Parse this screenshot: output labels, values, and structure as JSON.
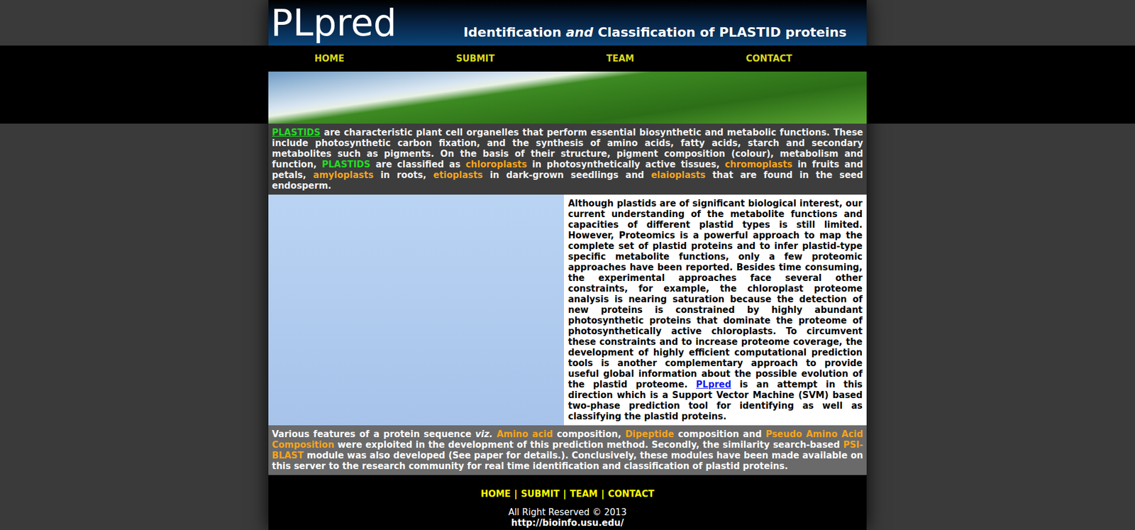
{
  "header": {
    "logo": "PLpred",
    "title": [
      {
        "text": "Identification ",
        "kind": "plain"
      },
      {
        "text": "and",
        "kind": "italic"
      },
      {
        "text": " Classification of PLASTID proteins",
        "kind": "plain"
      }
    ]
  },
  "nav": [
    {
      "label": "HOME"
    },
    {
      "label": "SUBMIT"
    },
    {
      "label": "TEAM"
    },
    {
      "label": "CONTACT"
    }
  ],
  "intro": {
    "segments": [
      {
        "text": "PLASTIDS",
        "kind": "greenlink"
      },
      {
        "text": " are characteristic plant cell organelles that perform essential biosynthetic and metabolic functions. These include photosynthetic carbon fixation, and the synthesis of amino acids, fatty acids, starch and secondary metabolites such as pigments. On the basis of their structure, pigment composition (colour), metabolism and function, ",
        "kind": "plain"
      },
      {
        "text": "PLASTIDS",
        "kind": "green"
      },
      {
        "text": " are classified as ",
        "kind": "plain"
      },
      {
        "text": "chloroplasts",
        "kind": "orange"
      },
      {
        "text": " in photosynthetically active tissues, ",
        "kind": "plain"
      },
      {
        "text": "chromoplasts",
        "kind": "orange"
      },
      {
        "text": " in fruits and petals, ",
        "kind": "plain"
      },
      {
        "text": "amyloplasts",
        "kind": "orange"
      },
      {
        "text": " in roots, ",
        "kind": "plain"
      },
      {
        "text": "etioplasts",
        "kind": "orange"
      },
      {
        "text": " in dark-grown seedlings and ",
        "kind": "plain"
      },
      {
        "text": "elaioplasts",
        "kind": "orange"
      },
      {
        "text": " that are found in the seed endosperm.",
        "kind": "plain"
      }
    ]
  },
  "about": {
    "segments": [
      {
        "text": "Although plastids are of significant biological interest, our current understanding of the metabolite functions and capacities of different plastid types is still limited. However, Proteomics is a powerful approach to map the complete set of plastid proteins and to infer plastid-type specific metabolite functions, only a few proteomic approaches have been reported. Besides time consuming, the experimental approaches face several other constraints, for example, the chloroplast proteome analysis is nearing saturation because the detection of new proteins is constrained by highly abundant photosynthetic proteins that dominate the proteome of photosynthetically active chloroplasts. To circumvent these constraints and to increase proteome coverage, the development of highly efficient computational prediction tools is another complementary approach to provide useful global information about the possible evolution of the plastid proteome. ",
        "kind": "plain"
      },
      {
        "text": "PLpred",
        "kind": "bluelink"
      },
      {
        "text": " is an attempt in this direction which is a Support Vector Machine (SVM) based two-phase prediction tool for identifying as well as classifying the plastid proteins.",
        "kind": "plain"
      }
    ]
  },
  "features": {
    "segments": [
      {
        "text": "Various features of a protein sequence ",
        "kind": "plain"
      },
      {
        "text": "viz.",
        "kind": "italic"
      },
      {
        "text": " ",
        "kind": "plain"
      },
      {
        "text": "Amino acid",
        "kind": "orange"
      },
      {
        "text": " composition, ",
        "kind": "plain"
      },
      {
        "text": "Dipeptide",
        "kind": "orange"
      },
      {
        "text": " composition and ",
        "kind": "plain"
      },
      {
        "text": "Pseudo Amino Acid Composition",
        "kind": "orange"
      },
      {
        "text": " were exploited in the development of this prediction method. Secondly, the similarity search-based ",
        "kind": "plain"
      },
      {
        "text": "PSI-BLAST",
        "kind": "orange"
      },
      {
        "text": " module was also developed (See paper for details.). Conclusively, these modules have been made available on this server to the research community for real time identification and classification of plastid proteins.",
        "kind": "plain"
      }
    ]
  },
  "footer": {
    "links": [
      {
        "label": "HOME"
      },
      {
        "label": "SUBMIT"
      },
      {
        "label": "TEAM"
      },
      {
        "label": "CONTACT"
      }
    ],
    "separators": [
      "|",
      "|",
      "|"
    ],
    "copyright": "All Right Reserved © 2013",
    "url": "http://bioinfo.usu.edu/"
  }
}
